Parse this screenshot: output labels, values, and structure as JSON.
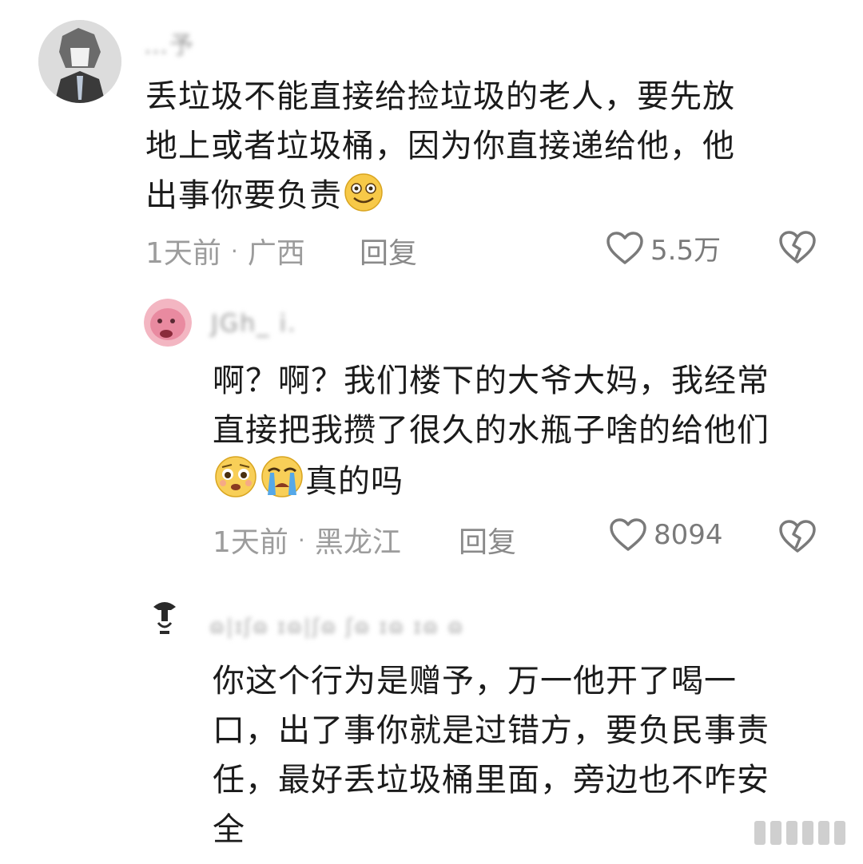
{
  "comments": [
    {
      "username": "…予",
      "lines": [
        "丢垃圾不能直接给捡垃圾的老人，要先放",
        "地上或者垃圾桶，因为你直接递给他，他",
        "出事你要负责"
      ],
      "emojis": [
        "smile-emoji"
      ],
      "time": "1天前",
      "location": "广西",
      "reply": "回复",
      "likes": "5.5万"
    },
    {
      "username": "JGh_ i.",
      "lines": [
        "啊？啊？我们楼下的大爷大妈，我经常",
        "直接把我攒了很久的水瓶子啥的给他们",
        "真的吗"
      ],
      "emojis": [
        "pleading-emoji",
        "crying-emoji"
      ],
      "time": "1天前",
      "location": "黑龙江",
      "reply": "回复",
      "likes": "8094"
    },
    {
      "username": "ɷ|ɪʃɷ ɪɷ|ʃɷ ʃɷ ɪɷ ɪɷ ɷ",
      "lines": [
        "你这个行为是赠予，万一他开了喝一",
        "口，出了事你就是过错方，要负民事责",
        "任，最好丢垃圾桶里面，旁边也不咋安",
        "全"
      ]
    }
  ],
  "colors": {
    "text": "#1b1b1b",
    "meta": "#9c9c9c",
    "icon": "#7a7a7a"
  }
}
